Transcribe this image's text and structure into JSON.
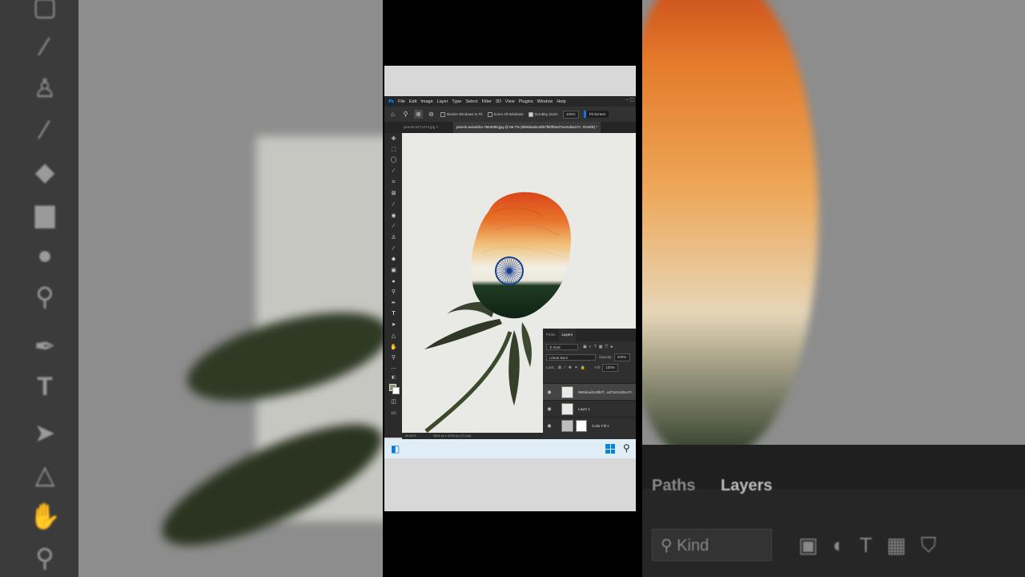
{
  "menubar": {
    "app_logo": "Ps",
    "items": [
      "File",
      "Edit",
      "Image",
      "Layer",
      "Type",
      "Select",
      "Filter",
      "3D",
      "View",
      "Plugins",
      "Window",
      "Help"
    ]
  },
  "options_bar": {
    "resize_windows": "Resize Windows to Fit",
    "zoom_all": "Zoom All Windows",
    "scrubby_zoom": "Scrubby Zoom",
    "zoom_value": "100%",
    "fit_screen": "Fit Screen"
  },
  "document_tabs": [
    {
      "label": "pexels-6271274.jpg",
      "active": false
    },
    {
      "label": "pexels-aolodsha-7664099.jpg @ 66.7% (990dead1c6f67f5f3f6a37ac0cd5ce7c, RGB/8) *",
      "active": true
    }
  ],
  "status_bar": {
    "zoom": "36.82%",
    "doc_size": "3024 px x 4032 px (72 ppi)"
  },
  "layers_panel": {
    "tabs": [
      "Paths",
      "Layers"
    ],
    "active_tab": "Layers",
    "kind_filter": "Kind",
    "blend_mode": "Linear Burn",
    "opacity_label": "Opacity:",
    "opacity_value": "100%",
    "lock_label": "Lock:",
    "fill_label": "Fill:",
    "fill_value": "100%",
    "layers": [
      {
        "name": "990dead1c6f67f...a37ac0cd5ce7c",
        "visible": true,
        "selected": true
      },
      {
        "name": "Layer 1",
        "visible": true,
        "selected": false
      },
      {
        "name": "Color Fill 1",
        "visible": true,
        "selected": false
      }
    ]
  },
  "background_panel": {
    "tabs": [
      "Paths",
      "Layers"
    ],
    "kind_filter": "Kind"
  },
  "colors": {
    "flag_saffron": "#e8722a",
    "flag_white": "#f2efe6",
    "flag_green": "#1f3a22",
    "chakra": "#1a3f8f",
    "accent": "#1473e6"
  }
}
